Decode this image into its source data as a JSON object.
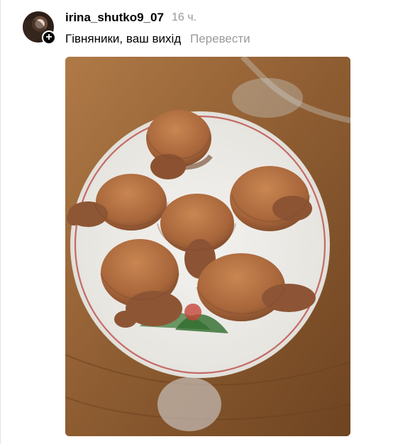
{
  "post": {
    "username": "irina_shutko9_07",
    "timestamp": "16 ч.",
    "caption": "Гівняники, ваш вихід",
    "translate_label": "Перевести"
  },
  "icons": {
    "follow": "plus-icon"
  },
  "colors": {
    "text_primary": "#000000",
    "text_secondary": "#9a9a9a"
  }
}
